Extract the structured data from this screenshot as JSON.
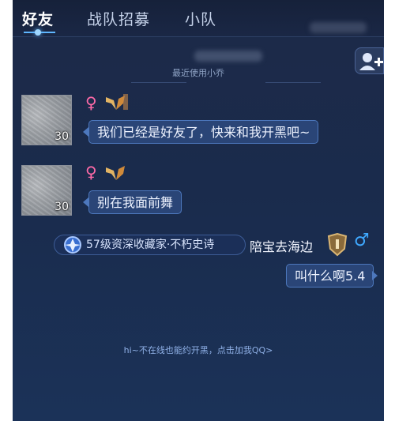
{
  "tabs": {
    "friends": "好友",
    "team_recruit": "战队招募",
    "squad": "小队"
  },
  "chat": {
    "subtitle": "最近使用小乔"
  },
  "messages": [
    {
      "level": "30",
      "text": "我们已经是好友了，快来和我开黑吧~"
    },
    {
      "level": "30",
      "text": "别在我面前舞"
    }
  ],
  "reply": {
    "rank_title": "57级资深收藏家·不朽史诗",
    "sender_name": "陪宝去海边",
    "text": "叫什么啊5.4"
  },
  "icons": {
    "female": "♀",
    "male": "♂"
  },
  "footer": {
    "invite_text": "hi~不在线也能约开黑，点击加我QQ>"
  },
  "colors": {
    "background": "#1a2b4c",
    "bubble": "#2a4577",
    "bubble_border": "#4d78bd",
    "female": "#ff6aa8",
    "male": "#3fa9ff",
    "accent": "#5fb6ff"
  }
}
